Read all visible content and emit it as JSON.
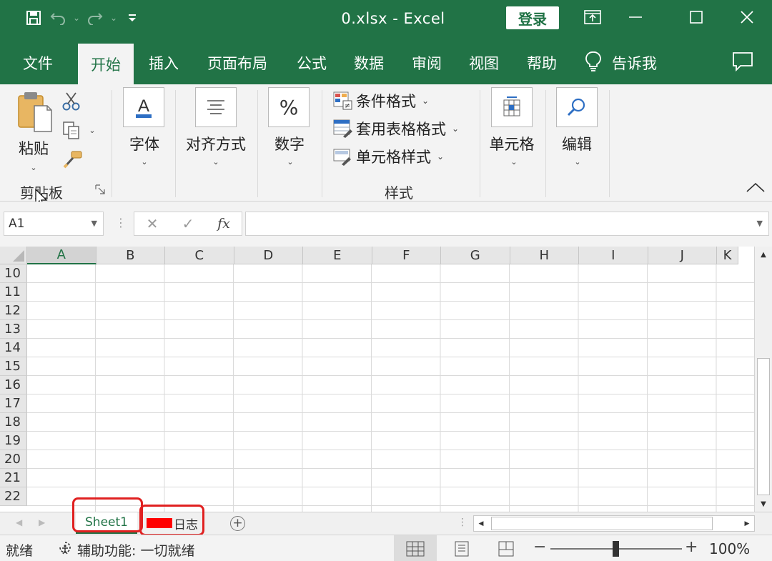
{
  "window": {
    "title": "0.xlsx  -  Excel",
    "login_label": "登录"
  },
  "ribbon_tabs": [
    "文件",
    "开始",
    "插入",
    "页面布局",
    "公式",
    "数据",
    "审阅",
    "视图",
    "帮助"
  ],
  "tell_me": "告诉我",
  "clipboard": {
    "paste_label": "粘贴",
    "group_name": "剪贴板"
  },
  "font": {
    "label": "字体"
  },
  "alignment": {
    "label": "对齐方式"
  },
  "number": {
    "label": "数字"
  },
  "styles": {
    "conditional_format": "条件格式",
    "format_as_table": "套用表格格式",
    "cell_styles": "单元格样式",
    "group_name": "样式"
  },
  "cells_group": {
    "label": "单元格"
  },
  "editing": {
    "label": "编辑"
  },
  "formula_bar": {
    "name_box": "A1",
    "formula": ""
  },
  "grid": {
    "columns": [
      "A",
      "B",
      "C",
      "D",
      "E",
      "F",
      "G",
      "H",
      "I",
      "J",
      "K"
    ],
    "rows": [
      "10",
      "11",
      "12",
      "13",
      "14",
      "15",
      "16",
      "17",
      "18",
      "19",
      "20",
      "21",
      "22"
    ],
    "selected_cell": "A1"
  },
  "sheets": {
    "active": "Sheet1",
    "second_visible": "日志"
  },
  "status": {
    "ready": "就绪",
    "accessibility": "辅助功能: 一切就绪",
    "zoom": "100%"
  },
  "colors": {
    "brand_green": "#217346",
    "highlight_red": "#e02020"
  }
}
